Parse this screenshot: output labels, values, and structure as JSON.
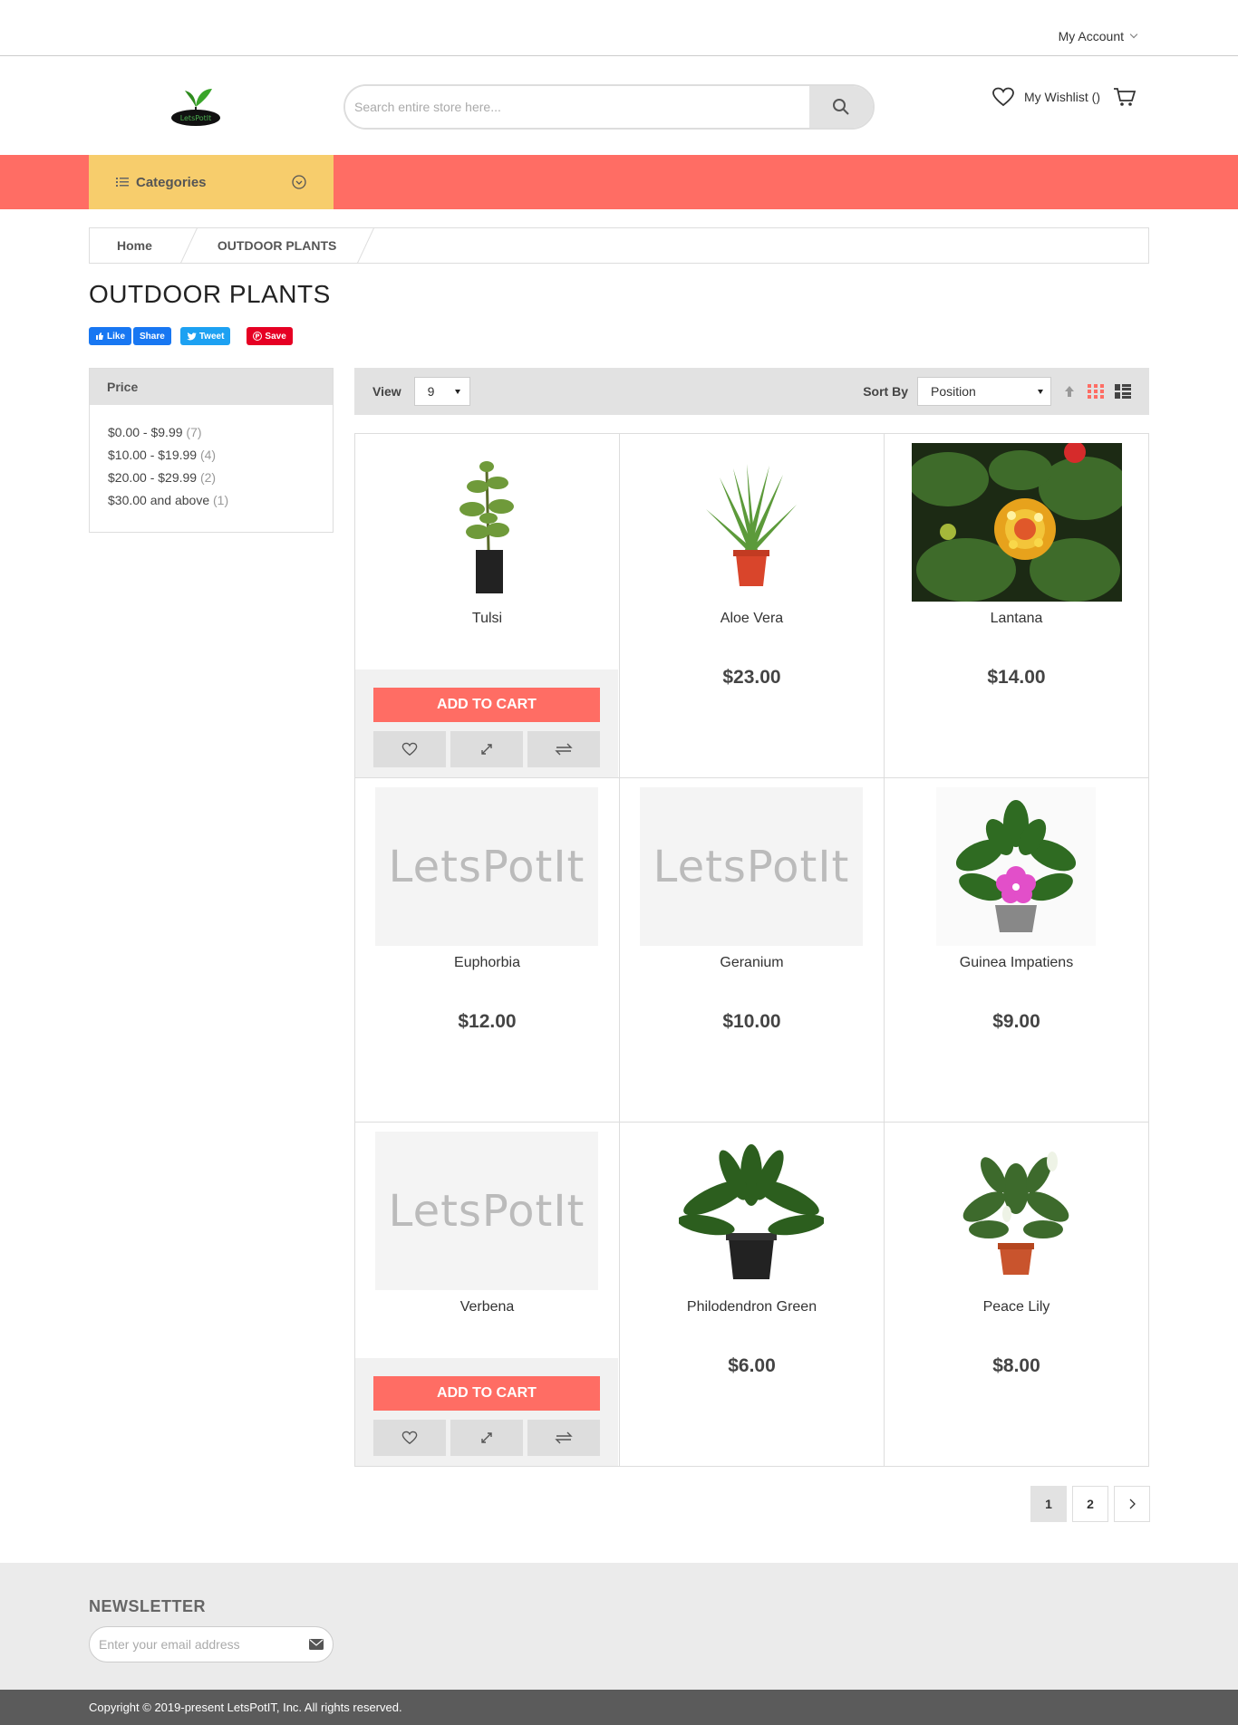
{
  "top": {
    "account_label": "My Account"
  },
  "header": {
    "search_placeholder": "Search entire store here...",
    "wishlist_label": "My Wishlist ()",
    "logo_text": "LetsPotIt"
  },
  "nav": {
    "categories_label": "Categories"
  },
  "breadcrumb": {
    "home": "Home",
    "current": "OUTDOOR PLANTS"
  },
  "page": {
    "title": "OUTDOOR PLANTS"
  },
  "social": {
    "like": "Like",
    "share": "Share",
    "tweet": "Tweet",
    "save": "Save"
  },
  "filter": {
    "title": "Price",
    "items": [
      {
        "label": "$0.00 - $9.99",
        "count": "(7)"
      },
      {
        "label": "$10.00 - $19.99",
        "count": "(4)"
      },
      {
        "label": "$20.00 - $29.99",
        "count": "(2)"
      },
      {
        "label": "$30.00 and above",
        "count": "(1)"
      }
    ]
  },
  "toolbar": {
    "view_label": "View",
    "view_value": "9",
    "sort_label": "Sort By",
    "sort_value": "Position"
  },
  "products": [
    {
      "name": "Tulsi",
      "price": "",
      "image": "tulsi-plant"
    },
    {
      "name": "Aloe Vera",
      "price": "$23.00",
      "image": "aloe-vera-plant"
    },
    {
      "name": "Lantana",
      "price": "$14.00",
      "image": "lantana-flower"
    },
    {
      "name": "Euphorbia",
      "price": "$12.00",
      "image": "placeholder"
    },
    {
      "name": "Geranium",
      "price": "$10.00",
      "image": "placeholder"
    },
    {
      "name": "Guinea Impatiens",
      "price": "$9.00",
      "image": "guinea-impatiens-plant"
    },
    {
      "name": "Verbena",
      "price": "",
      "image": "placeholder"
    },
    {
      "name": "Philodendron Green",
      "price": "$6.00",
      "image": "philodendron-plant"
    },
    {
      "name": "Peace Lily",
      "price": "$8.00",
      "image": "peace-lily-plant"
    }
  ],
  "actions": {
    "add_to_cart": "ADD TO CART"
  },
  "placeholder_text": "LetsPotIt",
  "pagination": {
    "pages": [
      "1",
      "2"
    ],
    "current": "1"
  },
  "footer": {
    "newsletter_title": "NEWSLETTER",
    "email_placeholder": "Enter your email address",
    "copyright": "Copyright © 2019-present LetsPotIT, Inc. All rights reserved."
  },
  "colors": {
    "accent": "#ff6d64",
    "categories_bg": "#f7cd6c",
    "toolbar_bg": "#e2e2e2"
  }
}
